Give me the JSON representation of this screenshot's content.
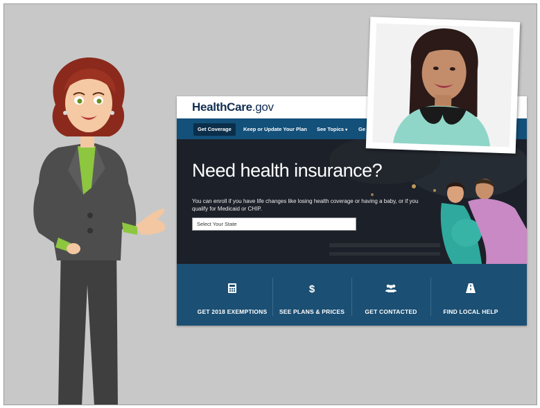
{
  "site": {
    "logo_health": "Health",
    "logo_care": "Care",
    "logo_gov": ".gov",
    "nav": {
      "get_coverage": "Get Coverage",
      "keep_update": "Keep or Update Your Plan",
      "see_topics": "See Topics",
      "see_topics_caret": "▾",
      "truncated": "Ge"
    },
    "hero": {
      "title": "Need health insurance?",
      "subtitle": "You can enroll if you have life changes like losing health coverage or having a baby, or if you qualify for Medicaid or CHIP.",
      "state_select": "Select Your State"
    },
    "cta": [
      {
        "icon": "calculator-icon",
        "label": "GET 2018 EXEMPTIONS"
      },
      {
        "icon": "dollar-icon",
        "glyph": "$",
        "label": "SEE PLANS & PRICES"
      },
      {
        "icon": "people-icon",
        "label": "GET CONTACTED"
      },
      {
        "icon": "road-icon",
        "label": "FIND LOCAL HELP"
      }
    ]
  },
  "colors": {
    "slide_bg": "#c8c8c8",
    "nav_bg": "#13507a",
    "cta_bg": "#1b4f73",
    "hero_bg": "#1a1d24",
    "suit": "#4a4a4a",
    "blouse": "#8dc63f",
    "hair": "#8b2a1c"
  }
}
